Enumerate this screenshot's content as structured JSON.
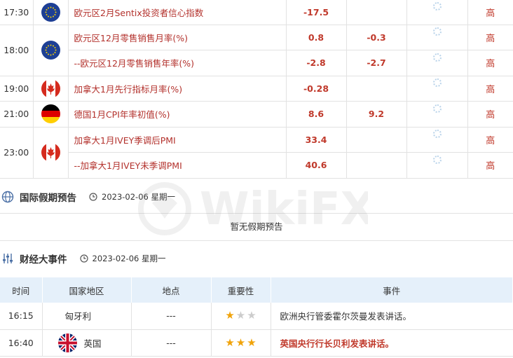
{
  "econ_rows": [
    {
      "time": "17:30",
      "flag": "eu-flag-icon",
      "name": "欧元区2月Sentix投资者信心指数",
      "actual": "-17.5",
      "forecast": "",
      "importance": "高"
    },
    {
      "time": "18:00",
      "flag": "eu-flag-icon",
      "name": "欧元区12月零售销售月率(%)",
      "actual": "0.8",
      "forecast": "-0.3",
      "importance": "高"
    },
    {
      "time": "",
      "flag": "",
      "name": "--欧元区12月零售销售年率(%)",
      "actual": "-2.8",
      "forecast": "-2.7",
      "importance": "高"
    },
    {
      "time": "19:00",
      "flag": "canada-flag-icon",
      "name": "加拿大1月先行指标月率(%)",
      "actual": "-0.28",
      "forecast": "",
      "importance": "高"
    },
    {
      "time": "21:00",
      "flag": "germany-flag-icon",
      "name": "德国1月CPI年率初值(%)",
      "actual": "8.6",
      "forecast": "9.2",
      "importance": "高"
    },
    {
      "time": "23:00",
      "flag": "canada-flag-icon",
      "name": "加拿大1月IVEY季调后PMI",
      "actual": "33.4",
      "forecast": "",
      "importance": "高"
    },
    {
      "time": "",
      "flag": "",
      "name": "--加拿大1月IVEY未季调PMI",
      "actual": "40.6",
      "forecast": "",
      "importance": "高"
    }
  ],
  "holiday": {
    "title": "国际假期预告",
    "date": "2023-02-06 星期一",
    "empty_text": "暂无假期预告"
  },
  "events": {
    "title": "财经大事件",
    "date": "2023-02-06 星期一",
    "headers": [
      "时间",
      "国家地区",
      "地点",
      "重要性",
      "事件"
    ],
    "rows": [
      {
        "time": "16:15",
        "country": "匈牙利",
        "place": "---",
        "stars": 1,
        "event": "欧洲央行管委霍尔茨曼发表讲话。",
        "highlight": false
      },
      {
        "time": "16:40",
        "country": "英国",
        "place": "---",
        "stars": 3,
        "event": "英国央行行长贝利发表讲话。",
        "highlight": true
      }
    ]
  },
  "watermark_text": "WikiFX",
  "colors": {
    "accent_red": "#c0392b",
    "header_bg": "#e5f0fa",
    "star_on": "#f0a30a"
  }
}
